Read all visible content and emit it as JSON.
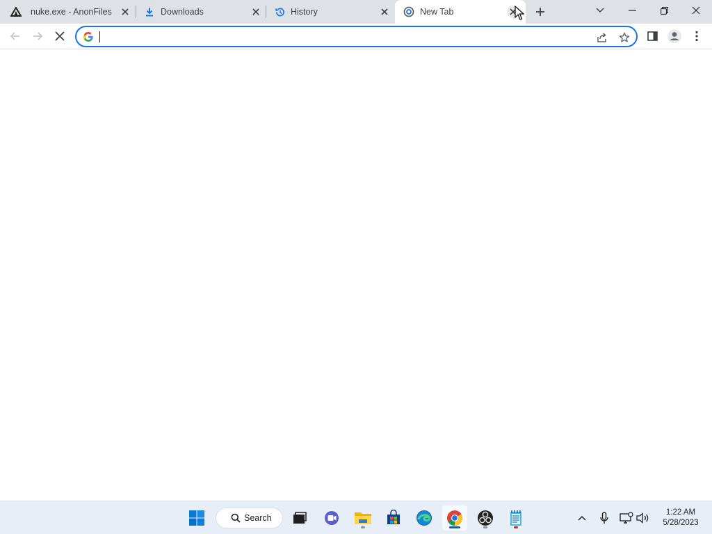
{
  "browser": {
    "tabs": [
      {
        "title": "nuke.exe - AnonFiles",
        "favicon": "anonfiles-icon",
        "active": false
      },
      {
        "title": "Downloads",
        "favicon": "download-icon",
        "active": false
      },
      {
        "title": "History",
        "favicon": "history-icon",
        "active": false
      },
      {
        "title": "New Tab",
        "favicon": "chrome-newtab-icon",
        "active": true
      }
    ],
    "omnibox": {
      "value": "",
      "placeholder": ""
    },
    "accent_color": "#1a73e8"
  },
  "taskbar": {
    "search_label": "Search",
    "pinned": [
      "windows-start-icon",
      "search",
      "task-view-icon",
      "teams-chat-icon",
      "file-explorer-icon",
      "microsoft-store-icon",
      "edge-icon",
      "chrome-icon",
      "obs-icon",
      "notepad-icon"
    ],
    "clock": {
      "time": "1:22 AM",
      "date": "5/28/2023"
    }
  }
}
